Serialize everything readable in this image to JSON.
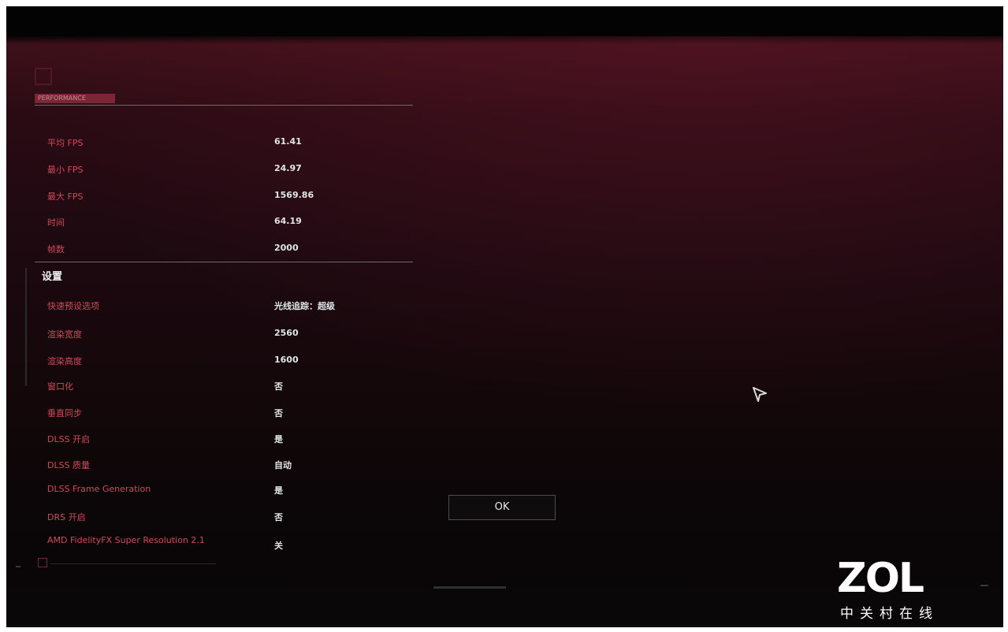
{
  "results": {
    "tab_label": "PERFORMANCE",
    "stats": [
      {
        "label": "平均 FPS",
        "value": "61.41"
      },
      {
        "label": "最小 FPS",
        "value": "24.97"
      },
      {
        "label": "最大 FPS",
        "value": "1569.86"
      },
      {
        "label": "时间",
        "value": "64.19"
      },
      {
        "label": "帧数",
        "value": "2000"
      }
    ]
  },
  "settings": {
    "title": "设置",
    "items": [
      {
        "label": "快速预设选项",
        "value": "光线追踪：超级"
      },
      {
        "label": "渲染宽度",
        "value": "2560"
      },
      {
        "label": "渲染高度",
        "value": "1600"
      },
      {
        "label": "窗口化",
        "value": "否"
      },
      {
        "label": "垂直同步",
        "value": "否"
      },
      {
        "label": "DLSS 开启",
        "value": "是"
      },
      {
        "label": "DLSS 质量",
        "value": "自动"
      },
      {
        "label": "DLSS Frame Generation",
        "value": "是"
      },
      {
        "label": "DRS 开启",
        "value": "否"
      },
      {
        "label": "AMD FidelityFX Super Resolution 2.1",
        "value": "关"
      }
    ]
  },
  "dialog": {
    "ok_label": "OK"
  },
  "watermark": {
    "logo": "ZOL",
    "subtitle": "中关村在线"
  },
  "colors": {
    "label": "#d04a58",
    "value": "#dfe6e7",
    "accent": "#8a2a3a"
  }
}
